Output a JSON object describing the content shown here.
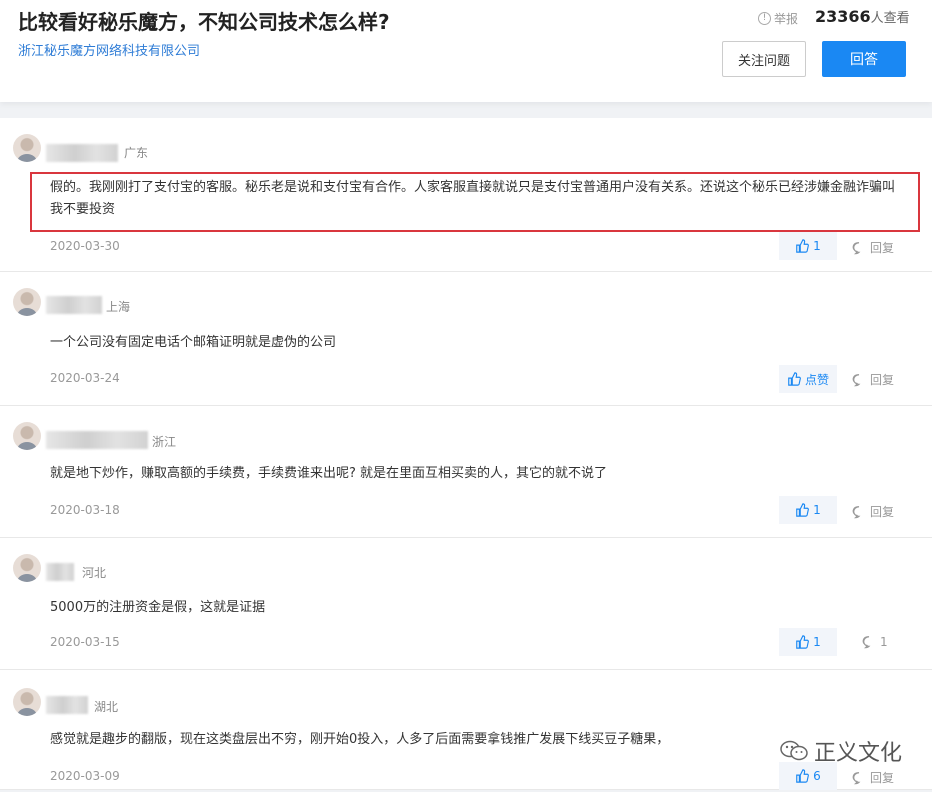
{
  "header": {
    "title": "比较看好秘乐魔方，不知公司技术怎么样?",
    "company": "浙江秘乐魔方网络科技有限公司",
    "report_label": "举报",
    "views_count": "23366",
    "views_suffix": "人查看",
    "follow_label": "关注问题",
    "answer_label": "回答"
  },
  "comments": [
    {
      "location": "广东",
      "text": "假的。我刚刚打了支付宝的客服。秘乐老是说和支付宝有合作。人家客服直接就说只是支付宝普通用户没有关系。还说这个秘乐已经涉嫌金融诈骗叫我不要投资",
      "date": "2020-03-30",
      "like": "1",
      "reply": "回复"
    },
    {
      "location": "上海",
      "text": "一个公司没有固定电话个邮箱证明就是虚伪的公司",
      "date": "2020-03-24",
      "like": "点赞",
      "reply": "回复"
    },
    {
      "location": "浙江",
      "text": "就是地下炒作，赚取高额的手续费，手续费谁来出呢? 就是在里面互相买卖的人，其它的就不说了",
      "date": "2020-03-18",
      "like": "1",
      "reply": "回复"
    },
    {
      "location": "河北",
      "text": "5000万的注册资金是假，这就是证据",
      "date": "2020-03-15",
      "like": "1",
      "reply": "1"
    },
    {
      "location": "湖北",
      "text": "感觉就是趣步的翻版，现在这类盘层出不穷，刚开始0投入，人多了后面需要拿钱推广发展下线买豆子糖果，",
      "date": "2020-03-09",
      "like": "6",
      "reply": "回复"
    }
  ],
  "watermark": "正义文化",
  "colors": {
    "accent": "#1a88f3",
    "highlight": "#d9363e",
    "link": "#2e7cd6"
  }
}
